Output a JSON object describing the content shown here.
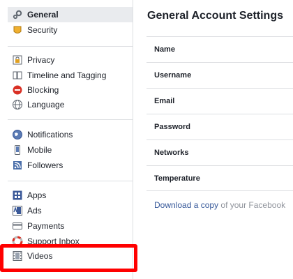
{
  "sidebar": {
    "groups": [
      {
        "items": [
          {
            "label": "General",
            "icon": "gears-icon",
            "active": true
          },
          {
            "label": "Security",
            "icon": "shield-badge-icon"
          }
        ]
      },
      {
        "items": [
          {
            "label": "Privacy",
            "icon": "padlock-icon"
          },
          {
            "label": "Timeline and Tagging",
            "icon": "timeline-icon"
          },
          {
            "label": "Blocking",
            "icon": "no-entry-icon"
          },
          {
            "label": "Language",
            "icon": "globe-icon"
          }
        ]
      },
      {
        "items": [
          {
            "label": "Notifications",
            "icon": "globe-notifications-icon"
          },
          {
            "label": "Mobile",
            "icon": "mobile-phone-icon"
          },
          {
            "label": "Followers",
            "icon": "rss-icon"
          }
        ]
      },
      {
        "items": [
          {
            "label": "Apps",
            "icon": "apps-grid-icon"
          },
          {
            "label": "Ads",
            "icon": "ads-icon"
          },
          {
            "label": "Payments",
            "icon": "payment-card-icon"
          },
          {
            "label": "Support Inbox",
            "icon": "lifebuoy-icon"
          },
          {
            "label": "Videos",
            "icon": "film-strip-icon"
          }
        ]
      }
    ]
  },
  "main": {
    "title": "General Account Settings",
    "rows": [
      {
        "label": "Name"
      },
      {
        "label": "Username"
      },
      {
        "label": "Email"
      },
      {
        "label": "Password"
      },
      {
        "label": "Networks"
      },
      {
        "label": "Temperature"
      }
    ],
    "download_link": "Download a copy",
    "download_suffix": " of your Facebook"
  },
  "colors": {
    "highlight": "#ff0000",
    "link": "#365899",
    "active_bg": "#e9ebee"
  }
}
